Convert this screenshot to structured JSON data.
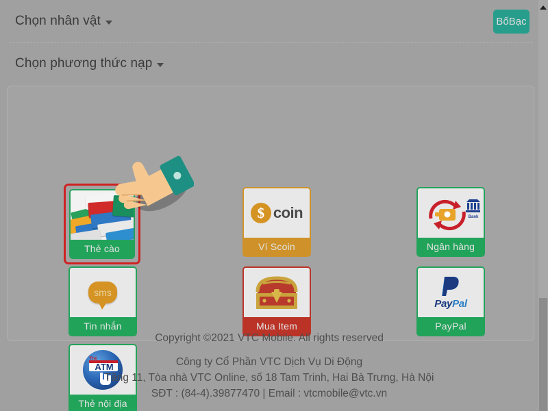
{
  "header": {
    "character_select": {
      "label": "Chọn nhân vật",
      "caret": "chevron-down-icon"
    },
    "method_select": {
      "label": "Chọn phương thức nạp",
      "caret": "chevron-down-icon"
    },
    "silver_button": {
      "label": "BốBạc",
      "color": "#279e8c"
    }
  },
  "payment_methods": [
    {
      "id": "the-cao",
      "label": "Thẻ cào",
      "icon": "scratch-card-icon",
      "theme": "green",
      "selected": true,
      "accent": "#22a35a",
      "highlight": "#cf2222"
    },
    {
      "id": "vi-scoin",
      "label": "Ví Scoin",
      "icon": "scoin-wallet-icon",
      "theme": "orange",
      "selected": false,
      "accent": "#cf922a",
      "badge_text": "coin",
      "coin_symbol": "$"
    },
    {
      "id": "ngan-hang",
      "label": "Ngân hàng",
      "icon": "bank-transfer-icon",
      "theme": "green",
      "selected": false,
      "accent": "#22a35a",
      "bank_caption": "Bank"
    },
    {
      "id": "tin-nhan",
      "label": "Tin nhắn",
      "icon": "sms-icon",
      "theme": "green",
      "selected": false,
      "accent": "#22a35a",
      "bubble_text": "sms"
    },
    {
      "id": "mua-item",
      "label": "Mua Item",
      "icon": "treasure-chest-icon",
      "theme": "red",
      "selected": false,
      "accent": "#bb3327"
    },
    {
      "id": "paypal",
      "label": "PayPal",
      "icon": "paypal-icon",
      "theme": "green",
      "selected": false,
      "accent": "#22a35a",
      "wordmark_1": "Pay",
      "wordmark_2": "Pal"
    },
    {
      "id": "the-noi-dia",
      "label": "Thẻ nội địa",
      "icon": "atm-card-icon",
      "theme": "green",
      "selected": false,
      "accent": "#22a35a",
      "atm_text": "ATM",
      "atm_prefix": "Thẻ"
    }
  ],
  "cursor": {
    "type": "pointing-hand-cursor",
    "skin": "#f6c88f",
    "sleeve": "#1e9083"
  },
  "footer": {
    "copyright": "Copyright ©2021 VTC Mobile. All rights reserved",
    "company": "Công ty Cổ Phần VTC Dịch Vụ Di Động",
    "address": "Tầng 11, Tòa nhà VTC Online, số 18 Tam Trinh, Hai Bà Trưng, Hà Nội",
    "contact": "SĐT : (84-4).39877470 | Email : vtcmobile@vtc.vn"
  },
  "scrollbar": {
    "up_arrow": "scroll-up-arrow-icon"
  }
}
